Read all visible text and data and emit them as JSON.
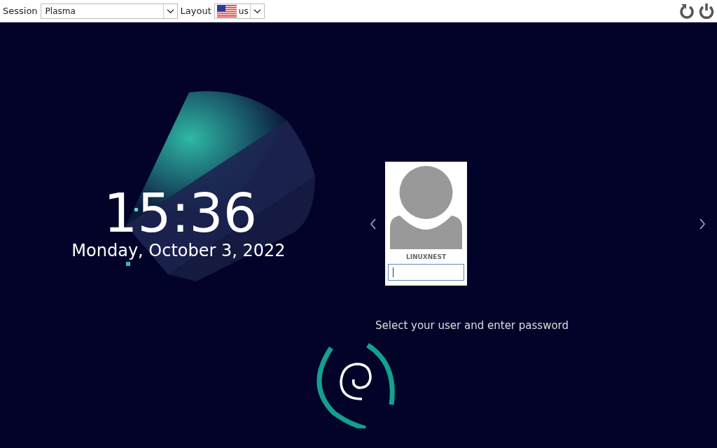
{
  "top_bar": {
    "session": {
      "label": "Session",
      "value": "Plasma"
    },
    "layout": {
      "label": "Layout",
      "value": "us"
    }
  },
  "clock": {
    "time": "15:36",
    "date": "Monday, October 3, 2022"
  },
  "user": {
    "name": "LINUXNEST"
  },
  "message": "Select your user and enter password"
}
